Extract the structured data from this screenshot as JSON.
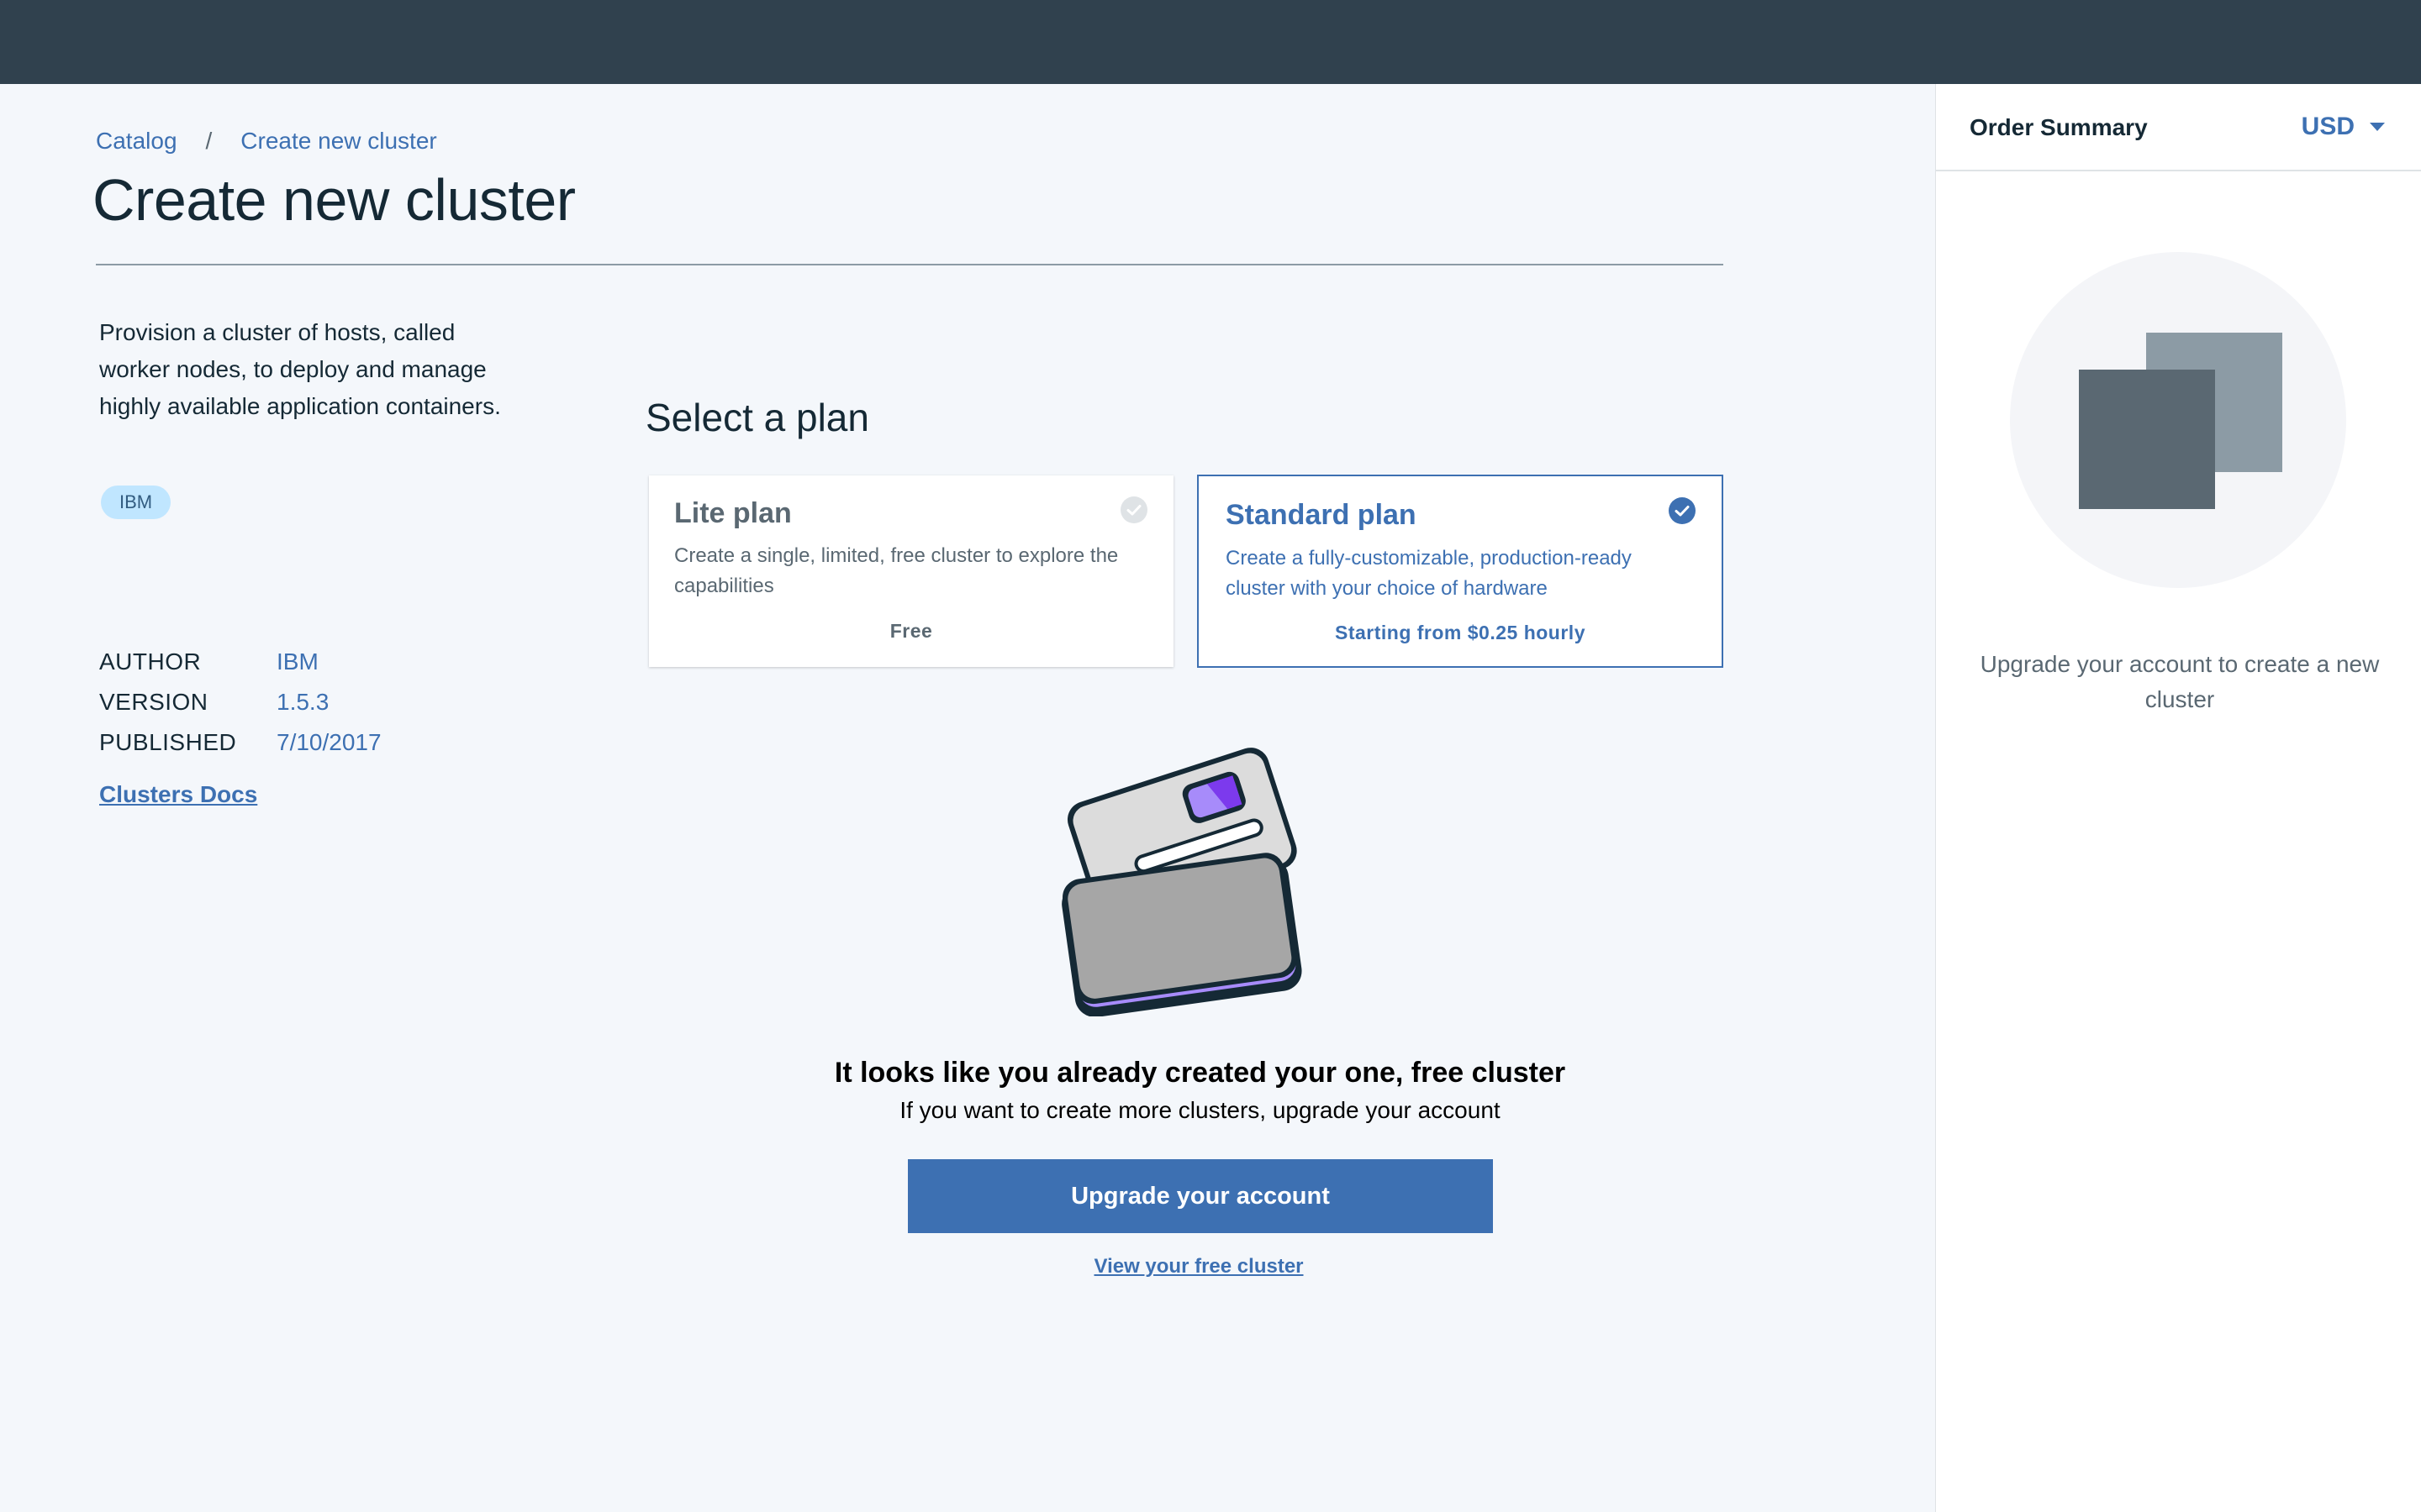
{
  "breadcrumb": {
    "items": [
      "Catalog",
      "Create new cluster"
    ],
    "separator": "/"
  },
  "page": {
    "title": "Create new cluster"
  },
  "sidebar": {
    "description": "Provision a cluster of hosts, called worker nodes, to deploy and manage highly available application containers.",
    "tag": "IBM",
    "meta": [
      {
        "label": "AUTHOR",
        "value": "IBM"
      },
      {
        "label": "VERSION",
        "value": "1.5.3"
      },
      {
        "label": "PUBLISHED",
        "value": "7/10/2017"
      }
    ],
    "docs_link": "Clusters Docs"
  },
  "plans": {
    "heading": "Select a plan",
    "items": [
      {
        "name": "Lite plan",
        "description": "Create a single, limited, free cluster to explore the capabilities",
        "price": "Free",
        "selected": false
      },
      {
        "name": "Standard plan",
        "description": "Create a fully-customizable, production-ready cluster with your choice of hardware",
        "price": "Starting from $0.25 hourly",
        "selected": true
      }
    ]
  },
  "notice": {
    "title": "It looks like you already created your one, free cluster",
    "subtitle": "If you want to create more clusters, upgrade your account",
    "button": "Upgrade your account",
    "link": "View your free cluster"
  },
  "order_summary": {
    "title": "Order Summary",
    "currency": "USD",
    "message": "Upgrade your account to create a new cluster"
  },
  "colors": {
    "topbar": "#30414e",
    "accent": "#3d70b2",
    "background": "#f4f7fb",
    "tag_bg": "#c0e6ff"
  },
  "icons": {
    "lite_check": "checkmark-circle-icon",
    "standard_check": "checkmark-circle-filled-icon",
    "currency_caret": "caret-down-icon",
    "illustration": "cluster-illustration",
    "order_graphic": "stacked-squares-icon"
  }
}
